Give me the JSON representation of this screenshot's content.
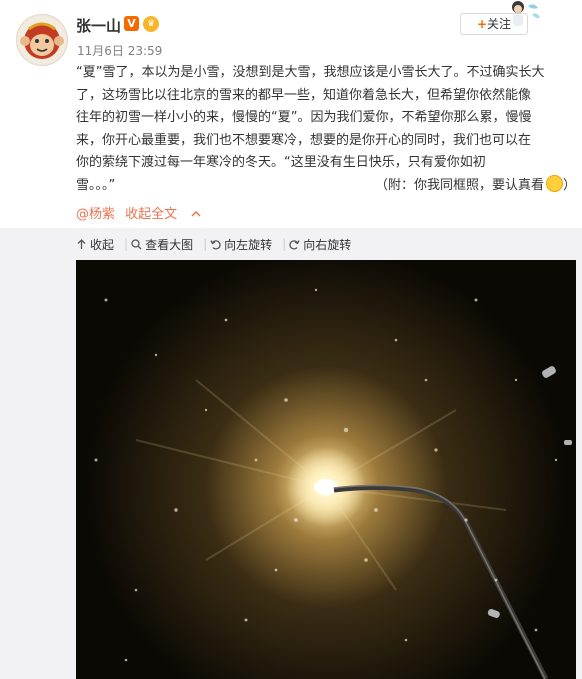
{
  "user": {
    "name": "张一山",
    "v_badge": "V",
    "timestamp": "11月6日 23:59"
  },
  "follow_button": {
    "plus": "+",
    "label": "关注"
  },
  "post": {
    "lines": [
      "“夏”雪了，本以为是小雪，没想到是大雪，我想应该是小雪长大了。不过确实长大",
      "了，这场雪比以往北京的雪来的都早一些，知道你着急长大，但希望你依然能像",
      "往年的初雪一样小小的来，慢慢的“夏”。因为我们爱你，不希望你那么累，慢慢",
      "来，你开心最重要，我们也不想要寒冷，想要的是你开心的同时，我们也可以在",
      "你的萦绕下渡过每一年寒冷的冬天。“这里没有生日快乐，只有爱你如初"
    ],
    "last_line_start": "雪。。。”",
    "last_line_note": "（附：你我同框照，要认真看",
    "last_line_close": "）"
  },
  "footer": {
    "mention": "@杨紫",
    "collapse": "收起全文",
    "collapse_icon": "chevron-up-icon"
  },
  "toolbar": {
    "items": [
      {
        "icon": "arrow-up-icon",
        "label": "收起"
      },
      {
        "icon": "magnifier-icon",
        "label": "查看大图"
      },
      {
        "icon": "rotate-left-icon",
        "label": "向左旋转"
      },
      {
        "icon": "rotate-right-icon",
        "label": "向右旋转"
      }
    ]
  },
  "colors": {
    "accent": "#eb7350",
    "orange": "#f56a00",
    "text": "#333333",
    "muted": "#808080"
  }
}
